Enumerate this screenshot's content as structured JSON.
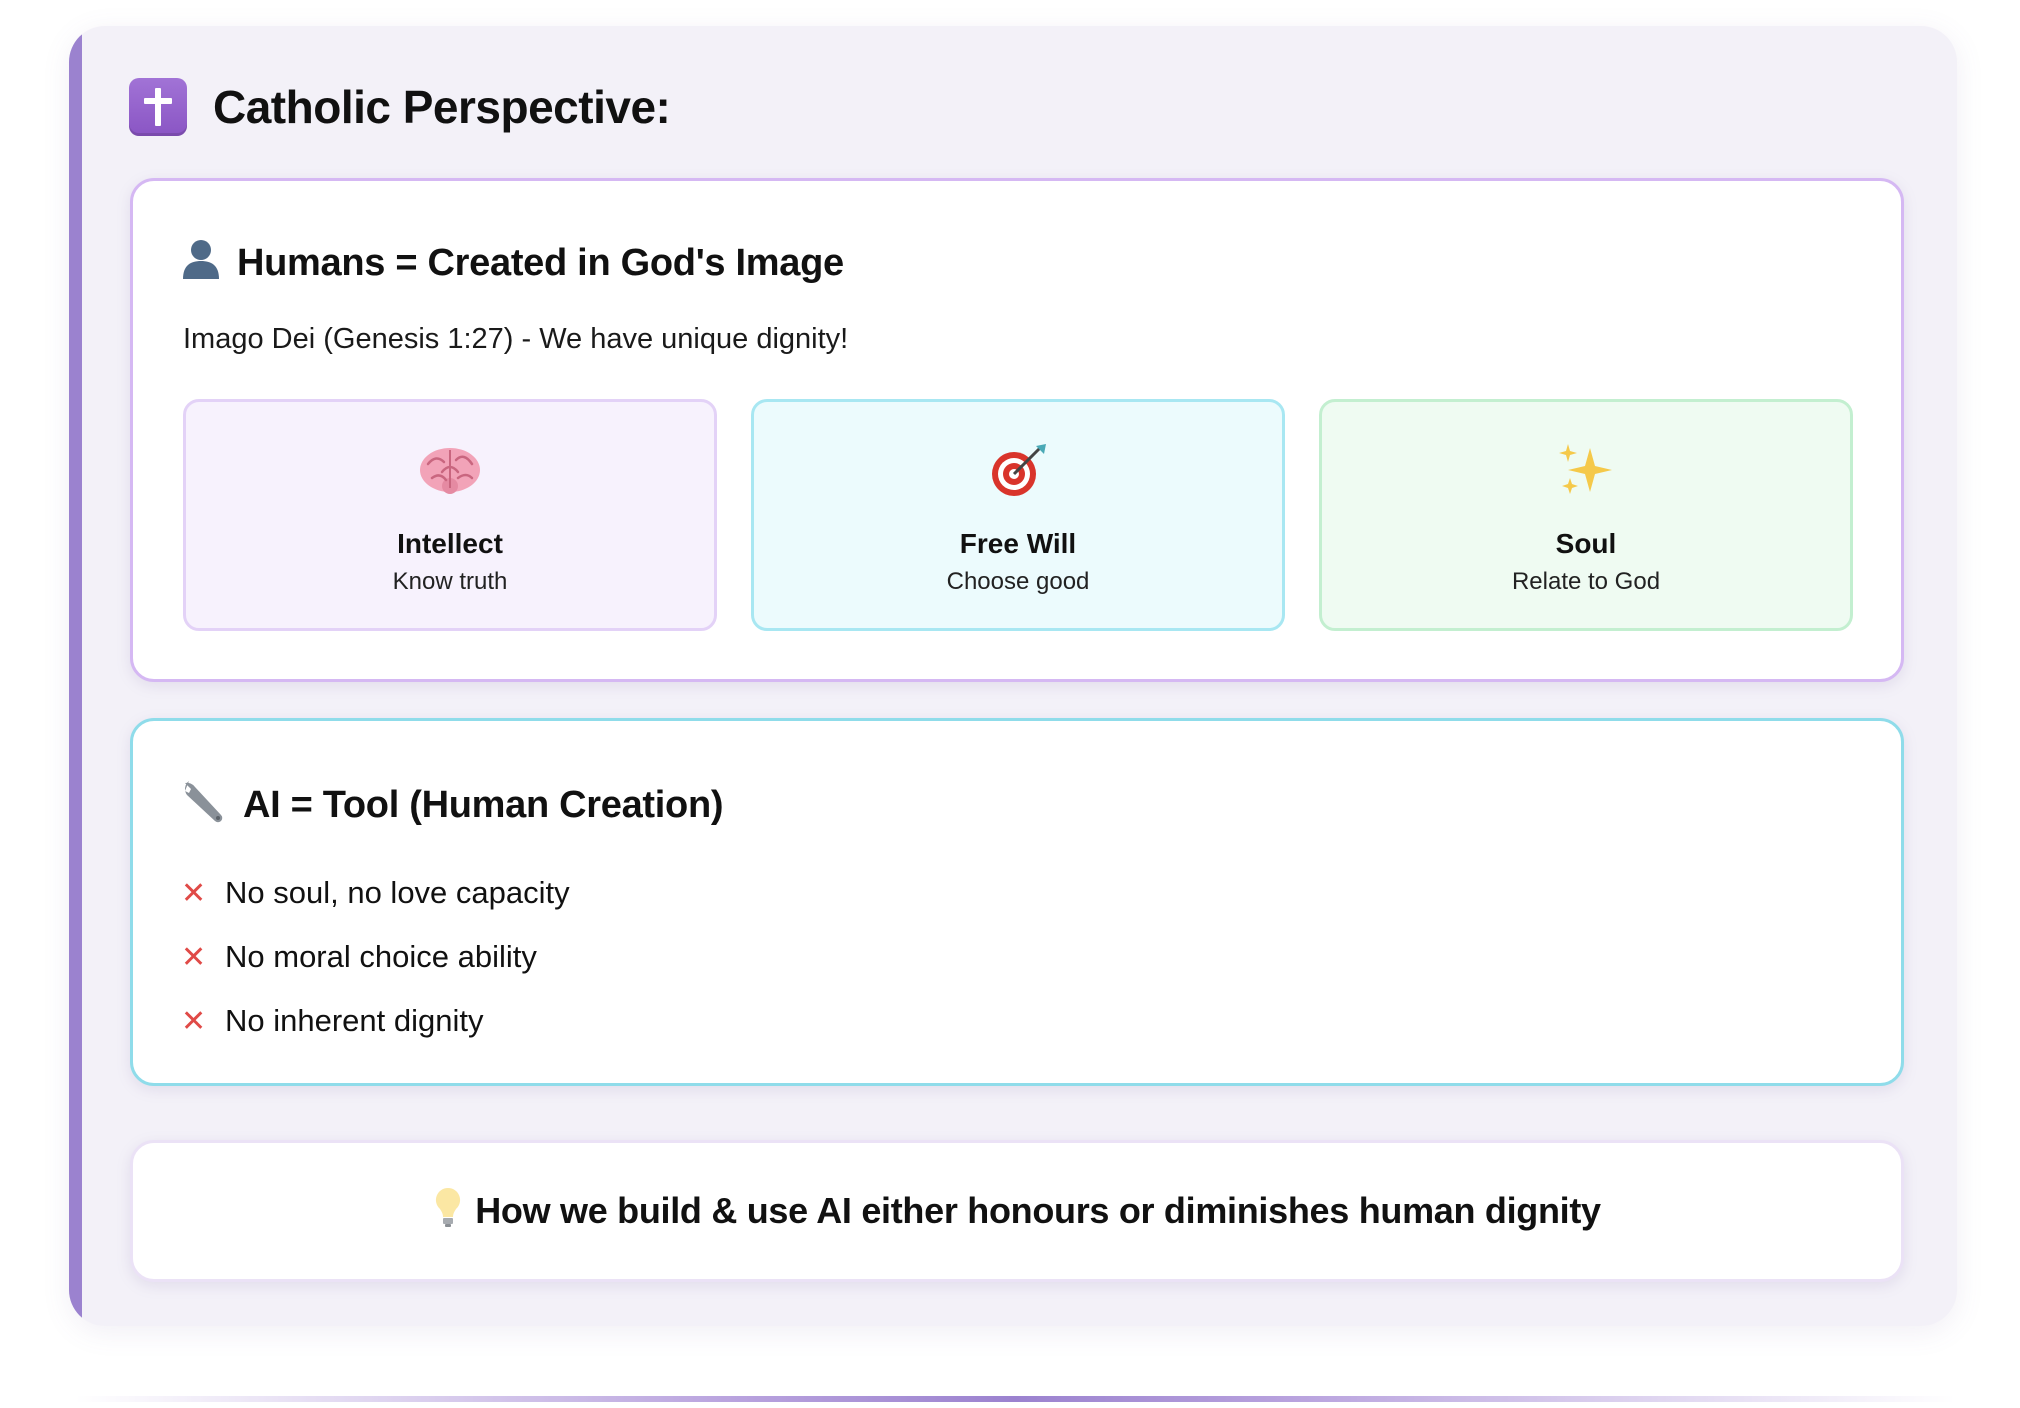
{
  "header": {
    "icon": "latin-cross-icon",
    "title": "Catholic Perspective:"
  },
  "humans": {
    "icon": "person-silhouette-icon",
    "title": "Humans = Created in God's Image",
    "subtitle": "Imago Dei (Genesis 1:27) - We have unique dignity!",
    "pillars": [
      {
        "icon": "brain-icon",
        "name": "Intellect",
        "desc": "Know truth",
        "color": "#e3d2f7"
      },
      {
        "icon": "target-icon",
        "name": "Free Will",
        "desc": "Choose good",
        "color": "#a8e7f2"
      },
      {
        "icon": "sparkles-icon",
        "name": "Soul",
        "desc": "Relate to God",
        "color": "#c3efd0"
      }
    ]
  },
  "ai": {
    "icon": "wrench-icon",
    "title": "AI = Tool (Human Creation)",
    "mark": "✕",
    "points": [
      "No soul, no love capacity",
      "No moral choice ability",
      "No inherent dignity"
    ]
  },
  "tip": {
    "icon": "light-bulb-icon",
    "text": "How we build & use AI either honours or diminishes human dignity"
  },
  "colors": {
    "accent": "#9b82cf",
    "humans_border": "#d5b8f3",
    "ai_border": "#8fdcea",
    "x_mark": "#e04a47"
  }
}
